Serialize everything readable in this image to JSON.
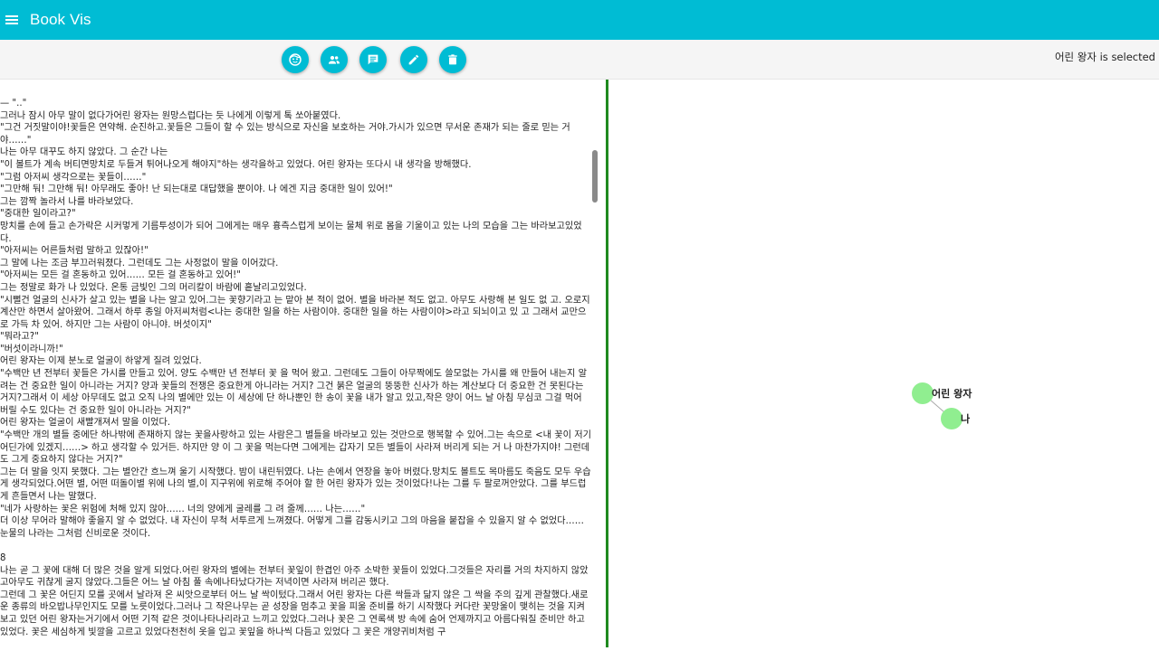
{
  "app": {
    "title": "Book Vis"
  },
  "icons": {
    "menu": "menu-icon"
  },
  "toolbar": {
    "buttons": [
      {
        "name": "face-button",
        "icon": "face-icon"
      },
      {
        "name": "people-button",
        "icon": "people-icon"
      },
      {
        "name": "comment-button",
        "icon": "comment-icon"
      },
      {
        "name": "edit-button",
        "icon": "pencil-icon"
      },
      {
        "name": "delete-button",
        "icon": "trash-icon"
      }
    ],
    "selected_text": "어린 왕자 is selected"
  },
  "colors": {
    "accent": "#00bcd4",
    "divider": "#1f8a1f",
    "node": "#90ee90"
  },
  "text_panel": {
    "lines": [
      "— \"..\"",
      "그러나 잠시 아무 말이 없다가어린 왕자는 원망스럽다는 듯 나에게 이렇게 톡 쏘아붙였다.",
      "\"그건 거짓말이야!꽃들은 연약해. 순진하고.꽃들은 그들이 할 수 있는 방식으로 자신을 보호하는 거야.가시가 있으면 무서운 존재가 되는 줄로 믿는 거야……\"",
      "나는 아무 대꾸도 하지 않았다. 그 순간 나는",
      "\"이 볼트가 계속 버티면망치로 두들겨 튀어나오게 해야지\"하는 생각을하고 있었다. 어린 왕자는 또다시 내 생각을 방해했다.",
      "\"그럼 아저씨 생각으로는 꽃들이……\"",
      "\"그만해 둬! 그만해 둬! 아무래도 좋아! 난 되는대로 대답했을 뿐이야. 나 에겐 지금 중대한 일이 있어!\"",
      "그는 깜짝 놀라서 나를 바라보았다.",
      "\"중대한 일이라고?\"",
      "망치를 손에 들고 손가락은 시커멓게 기름투성이가 되어 그에게는 매우 흉측스럽게 보이는 물체 위로 몸을 기울이고 있는 나의 모습을 그는 바라보고있었다.",
      "\"아저씨는 어른들처럼 말하고 있잖아!\"",
      "그 말에 나는 조금 부끄러워졌다. 그런데도 그는 사정없이 말을 이어갔다.",
      "\"아저씨는 모든 걸 혼동하고 있어…… 모든 걸 혼동하고 있어!\"",
      "그는 정말로 화가 나 있었다. 온통 금빛인 그의 머리칼이 바람에 흩날리고있었다.",
      "\"시뻘건 얼굴의 신사가 살고 있는 별을 나는 알고 있어.그는 꽃향기라고 는 맡아 본 적이 없어. 별을 바라본 적도 없고. 아무도 사랑해 본 일도 없 고. 오로지 계산만 하면서 살아왔어. 그래서 하루 종일 아저씨처럼<나는 중대한 일을 하는 사람이야. 중대한 일을 하는 사람이야>라고 되뇌이고 있 고 그래서 교만으로 가득 차 있어. 하지만 그는 사람이 아니야. 버섯이지\"",
      "\"뭐라고?\"",
      "\"버섯이라니까!\"",
      "어린 왕자는 이제 분노로 얼굴이 하얗게 질려 있었다.",
      "\"수백만 년 전부터 꽃들은 가시를 만들고 있어. 양도 수백만 년 전부터 꽃 을 먹어 왔고. 그런데도 그들이 아무짝에도 쓸모없는 가시를 왜 만들어 내는지 알려는 건 중요한 일이 아니라는 거지? 양과 꽃들의 전쟁은 중요한게 아니라는 거지? 그건 붉은 얼굴의 뚱뚱한 신사가 하는 계산보다 더 중요한 건 못된다는 거지?그래서 이 세상 아무데도 없고 오직 나의 별에만 있는 이 세상에 단 하나뿐인 한 송이 꽃을 내가 알고 있고,작은 양이 어느 날 아침 무심코 그걸 먹어 버릴 수도 있다는 건 중요한 일이 아니라는 거지?\"",
      "어린 왕자는 얼굴이 새빨개져서 말을 이었다.",
      "\"수백만 개의 별들 중에단 하나밖에 존재하지 않는 꽃을사랑하고 있는 사람은그 별들을 바라보고 있는 것만으로 행복할 수 있어.그는 속으로 <내 꽃이 저기 어딘가에 있겠지……> 하고 생각할 수 있거든. 하지만 양 이 그 꽃을 먹는다면 그에게는 갑자기 모든 별들이 사라져 버리게 되는 거 나 마찬가지야! 그런데도 그게 중요하지 않다는 거지?\"",
      "그는 더 말을 잇지 못했다. 그는 별안간 흐느껴 울기 시작했다. 밤이 내린뒤였다. 나는 손에서 연장을 놓아 버렸다.망치도 볼트도 목마름도 죽음도 모두 우습게 생각되었다.어떤 별, 어떤 떠돌이별 위에 나의 별,이 지구위에 위로해 주어야 할 한 어린 왕자가 있는 것이었다!나는 그를 두 팔로꺼안았다. 그를 부드럽게 흔들면서 나는 말했다.",
      "\"네가 사랑하는 꽃은 위험에 처해 있지 않아…… 너의 양에게 굴레를 그 려 줄께…… 나는……\"",
      "더 이상 무어라 말해야 좋을지 알 수 없었다. 내 자신이 무척 서투르게 느껴졌다. 어떻게 그를 감동시키고 그의 마음을 붙잡을 수 있을지 알 수 없었다…… 눈물의 나라는 그처럼 신비로운 것이다.",
      "",
      "8",
      "나는 곧 그 꽃에 대해 더 많은 것을 알게 되었다.어린 왕자의 별에는 전부터 꽃잎이 한겹인 아주 소박한 꽃들이 있었다.그것들은 자리를 거의 차지하지 않았고아무도 귀찮게 굴지 않았다.그들은 어느 날 아침 풀 속에나타났다가는 저녁이면 사라져 버리곤 했다.",
      "그런데 그 꽃은 어딘지 모를 곳에서 날라져 온 씨앗으로부터 어느 날 싹이텄다.그래서 어린 왕자는 다른 싹들과 닮지 않은 그 싹을 주의 깊게 관찰했다.새로운 종류의 바오밥나무인지도 모를 노릇이었다.그러나 그 작은나무는 곧 성장을 멈추고 꽃을 피울 준비를 하기 시작했다 커다란 꽃망울이 맺히는 것을 지켜보고 있던 어린 왕자는거기에서 어떤 기적 같은 것이나타나리라고 느끼고 있었다.그러나 꽃은 그 연록색 방 속에 숨어 언제까지고 아름다워질 준비만 하고 있었다. 꽃은 세심하게 빛깔을 고르고 있었다천천히 옷을 입고 꽃잎을 하나씩 다듬고 있었다 그 꽃은 개양귀비처럼 구"
    ]
  },
  "graph": {
    "nodes": [
      {
        "id": "n1",
        "label": "어린 왕자"
      },
      {
        "id": "n2",
        "label": "나"
      }
    ],
    "edges": [
      {
        "from": "n1",
        "to": "n2"
      }
    ]
  }
}
